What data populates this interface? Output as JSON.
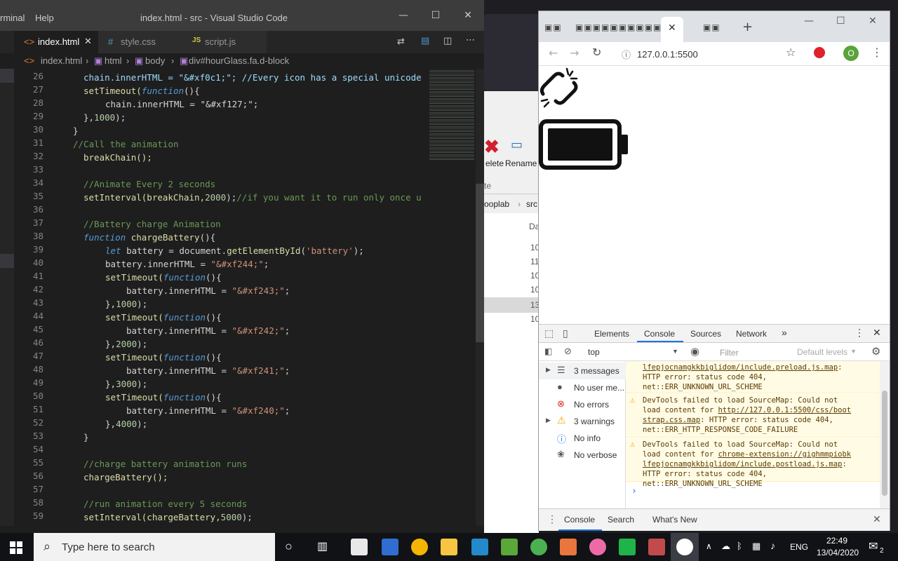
{
  "vscode": {
    "menu_terminal": "rminal",
    "menu_help": "Help",
    "window_title": "index.html - src - Visual Studio Code",
    "tabs": [
      {
        "label": "index.html",
        "icon": "html-icon"
      },
      {
        "label": "style.css",
        "icon": "css-icon"
      },
      {
        "label": "script.js",
        "icon": "js-icon"
      }
    ],
    "breadcrumb": [
      "index.html",
      "html",
      "body",
      "div#hourGlass.fa.d-block"
    ],
    "line_numbers": [
      "26",
      "27",
      "28",
      "29",
      "30",
      "31",
      "32",
      "33",
      "34",
      "35",
      "36",
      "37",
      "38",
      "39",
      "40",
      "41",
      "42",
      "43",
      "44",
      "45",
      "46",
      "47",
      "48",
      "49",
      "50",
      "51",
      "52",
      "53",
      "54",
      "55",
      "56",
      "57",
      "58",
      "59"
    ],
    "code": {
      "l26": "chain.innerHTML = \"&#xf0c1;\"; //Every icon has a special unicode",
      "l27a": "setTimeout(",
      "l27b": "function",
      "l27c": "(){",
      "l28": "chain.innerHTML = \"&#xf127;\";",
      "l29a": "},",
      "l29b": "1000",
      "l29c": ");",
      "l30": "}",
      "l31": "//Call the animation",
      "l32": "breakChain();",
      "l34": "//Animate Every 2 seconds",
      "l35a": "setInterval(breakChain,",
      "l35b": "2000",
      "l35c": ");",
      "l35d": "//if you want it to run only once u",
      "l37": "//Battery charge Animation",
      "l38a": "function",
      "l38b": " chargeBattery",
      "l38c": "(){",
      "l39a": "let",
      "l39b": " battery = document.",
      "l39c": "getElementById",
      "l39d": "(",
      "l39e": "'battery'",
      "l39f": ");",
      "l40a": "battery.innerHTML = ",
      "l40b": "\"&#xf244;\"",
      "l40c": ";",
      "l41a": "setTimeout(",
      "l41b": "function",
      "l41c": "(){",
      "l42a": "battery.innerHTML = ",
      "l42b": "\"&#xf243;\"",
      "l42c": ";",
      "l43a": "},",
      "l43b": "1000",
      "l43c": ");",
      "l44a": "setTimeout(",
      "l44b": "function",
      "l44c": "(){",
      "l45a": "battery.innerHTML = ",
      "l45b": "\"&#xf242;\"",
      "l45c": ";",
      "l46a": "},",
      "l46b": "2000",
      "l46c": ");",
      "l47a": "setTimeout(",
      "l47b": "function",
      "l47c": "(){",
      "l48a": "battery.innerHTML = ",
      "l48b": "\"&#xf241;\"",
      "l48c": ";",
      "l49a": "},",
      "l49b": "3000",
      "l49c": ");",
      "l50a": "setTimeout(",
      "l50b": "function",
      "l50c": "(){",
      "l51a": "battery.innerHTML = ",
      "l51b": "\"&#xf240;\"",
      "l51c": ";",
      "l52a": "},",
      "l52b": "4000",
      "l52c": ");",
      "l53": "}",
      "l55": "//charge battery animation runs",
      "l56": "chargeBattery();",
      "l58": "//run animation every 5 seconds",
      "l59a": "setInterval(chargeBattery,",
      "l59b": "5000",
      "l59c": ");"
    }
  },
  "explorer": {
    "delete_label": "elete",
    "rename_label": "Rename",
    "ribbon_small": "te",
    "path_parent": "ooplab",
    "path_child": "src",
    "col_header": "Da",
    "rows": [
      "10",
      "11",
      "10",
      "10",
      "13",
      "10"
    ]
  },
  "chrome": {
    "url": "127.0.0.1:5500",
    "profile_initial": "O"
  },
  "devtools": {
    "tabs": [
      "Elements",
      "Console",
      "Sources",
      "Network"
    ],
    "context": "top",
    "filter_placeholder": "Filter",
    "levels": "Default levels",
    "sidebar": [
      {
        "label": "3 messages",
        "icon": "list-icon"
      },
      {
        "label": "No user me...",
        "icon": "user-icon"
      },
      {
        "label": "No errors",
        "icon": "error-icon"
      },
      {
        "label": "3 warnings",
        "icon": "warning-icon"
      },
      {
        "label": "No info",
        "icon": "info-icon"
      },
      {
        "label": "No verbose",
        "icon": "bug-icon"
      }
    ],
    "messages": [
      {
        "pre": "",
        "link": "lfepjocnamgkkbiglidom/include.preload.js.map",
        "post": ":\nHTTP error: status code 404,\nnet::ERR_UNKNOWN_URL_SCHEME"
      },
      {
        "pre": "DevTools failed to load SourceMap: Could not\nload content for ",
        "link": "http://127.0.0.1:5500/css/boot\nstrap.css.map",
        "post": ": HTTP error: status code 404,\nnet::ERR_HTTP_RESPONSE_CODE_FAILURE"
      },
      {
        "pre": "DevTools failed to load SourceMap: Could not\nload content for ",
        "link": "chrome-extension://gighmmpiobk\nlfepjocnamgkkbiglidom/include.postload.js.map",
        "post": ":\nHTTP error: status code 404,\nnet::ERR_UNKNOWN_URL_SCHEME"
      }
    ],
    "drawer_tabs": [
      "Console",
      "Search",
      "What's New"
    ]
  },
  "taskbar": {
    "search_placeholder": "Type here to search",
    "language": "ENG",
    "time": "22:49",
    "date": "13/04/2020",
    "notifications": "2"
  },
  "colors": {
    "vscode_bg": "#1e1e1e",
    "accent_blue": "#1a73e8",
    "warning_bg": "#fffbe5"
  }
}
